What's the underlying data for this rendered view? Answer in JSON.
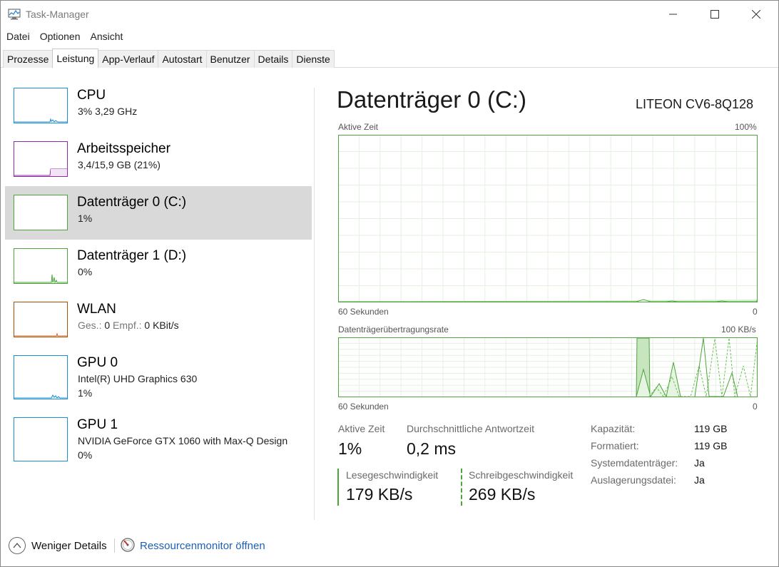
{
  "window": {
    "title": "Task-Manager",
    "icon": "task-manager-icon",
    "controls": [
      "minimize-icon",
      "maximize-icon",
      "close-icon"
    ]
  },
  "menu": [
    "Datei",
    "Optionen",
    "Ansicht"
  ],
  "tabs": [
    {
      "label": "Prozesse"
    },
    {
      "label": "Leistung",
      "active": true
    },
    {
      "label": "App-Verlauf"
    },
    {
      "label": "Autostart"
    },
    {
      "label": "Benutzer"
    },
    {
      "label": "Details"
    },
    {
      "label": "Dienste"
    }
  ],
  "sidebar": {
    "items": [
      {
        "name": "CPU",
        "sub": "3%  3,29 GHz",
        "color": "#1b8fd2"
      },
      {
        "name": "Arbeitsspeicher",
        "sub": "3,4/15,9 GB (21%)",
        "color": "#8e2aa6"
      },
      {
        "name": "Datenträger 0 (C:)",
        "sub": "1%",
        "color": "#4da43b",
        "selected": true
      },
      {
        "name": "Datenträger 1 (D:)",
        "sub": "0%",
        "color": "#4da43b"
      },
      {
        "name": "WLAN",
        "sub_label1": "Ges.:",
        "sub_val1": "0",
        "sub_label2": "Empf.:",
        "sub_val2": "0 KBit/s",
        "color": "#a74f01"
      },
      {
        "name": "GPU 0",
        "sub": "Intel(R) UHD Graphics 630",
        "sub2": "1%",
        "color": "#1b8fd2"
      },
      {
        "name": "GPU 1",
        "sub": "NVIDIA GeForce GTX 1060 with Max-Q Design",
        "sub2": "0%",
        "color": "#1b8fd2"
      }
    ]
  },
  "detail": {
    "title": "Datenträger 0 (C:)",
    "model": "LITEON CV6-8Q128",
    "graph1": {
      "label": "Aktive Zeit",
      "max": "100%",
      "time_label": "60 Sekunden",
      "min": "0"
    },
    "graph2": {
      "label": "Datenträgerübertragungsrate",
      "max": "100 KB/s",
      "time_label": "60 Sekunden",
      "min": "0"
    },
    "stats": {
      "active_time_label": "Aktive Zeit",
      "active_time_value": "1%",
      "response_label": "Durchschnittliche Antwortzeit",
      "response_value": "0,2 ms",
      "read_label": "Lesegeschwindigkeit",
      "read_value": "179 KB/s",
      "write_label": "Schreibgeschwindigkeit",
      "write_value": "269 KB/s"
    },
    "properties": [
      {
        "label": "Kapazität:",
        "value": "119 GB"
      },
      {
        "label": "Formatiert:",
        "value": "119 GB"
      },
      {
        "label": "Systemdatenträger:",
        "value": "Ja"
      },
      {
        "label": "Auslagerungsdatei:",
        "value": "Ja"
      }
    ],
    "accent": "#4da43b"
  },
  "footer": {
    "less_details": "Weniger Details",
    "resource_monitor": "Ressourcenmonitor öffnen"
  }
}
